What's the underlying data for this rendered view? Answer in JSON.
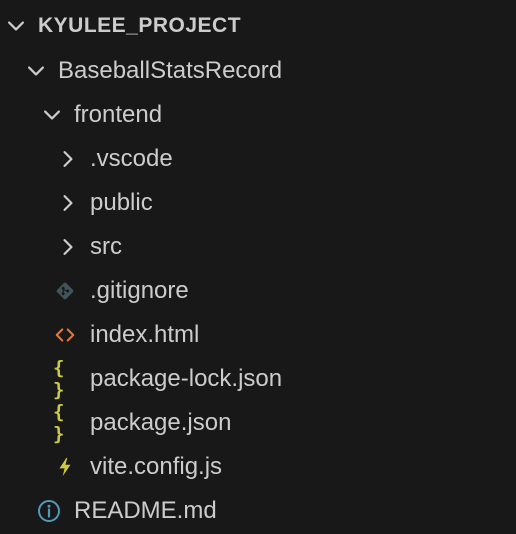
{
  "explorer": {
    "section_title": "KYULEE_PROJECT",
    "items": [
      {
        "label": "BaseballStatsRecord",
        "kind": "folder",
        "state": "expanded",
        "icon": "chevron-down-icon"
      },
      {
        "label": "frontend",
        "kind": "folder",
        "state": "expanded",
        "icon": "chevron-down-icon"
      },
      {
        "label": ".vscode",
        "kind": "folder",
        "state": "collapsed",
        "icon": "chevron-right-icon"
      },
      {
        "label": "public",
        "kind": "folder",
        "state": "collapsed",
        "icon": "chevron-right-icon"
      },
      {
        "label": "src",
        "kind": "folder",
        "state": "collapsed",
        "icon": "chevron-right-icon"
      },
      {
        "label": ".gitignore",
        "kind": "file",
        "icon": "git-icon"
      },
      {
        "label": "index.html",
        "kind": "file",
        "icon": "html-icon"
      },
      {
        "label": "package-lock.json",
        "kind": "file",
        "icon": "json-braces-icon"
      },
      {
        "label": "package.json",
        "kind": "file",
        "icon": "json-braces-icon"
      },
      {
        "label": "vite.config.js",
        "kind": "file",
        "icon": "vite-bolt-icon"
      },
      {
        "label": "README.md",
        "kind": "file",
        "icon": "info-icon"
      }
    ],
    "json_icon_glyph": "{ }"
  },
  "colors": {
    "background": "#181818",
    "text": "#cccccc",
    "git": "#41535b",
    "html": "#e37933",
    "json": "#cbcb41",
    "vite": "#cbcb41",
    "info": "#519aba"
  }
}
